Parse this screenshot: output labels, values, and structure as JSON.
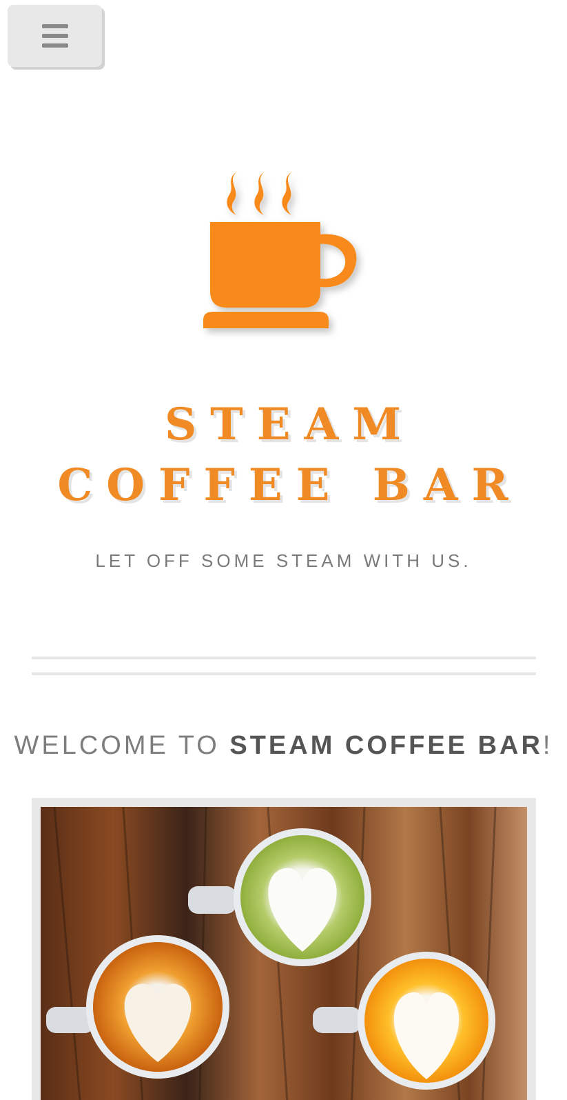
{
  "menu": {
    "icon": "hamburger-menu-icon"
  },
  "hero": {
    "logo_icon": "steaming-coffee-cup-icon",
    "title_line1": "STEAM",
    "title_line2": "COFFEE BAR",
    "tagline": "LET OFF SOME STEAM WITH US."
  },
  "welcome": {
    "prefix": "WELCOME TO ",
    "name": "STEAM COFFEE BAR",
    "suffix": "!"
  },
  "photo": {
    "subject": "latte-art-cups-photo"
  },
  "colors": {
    "accent": "#f08a24",
    "text_gray": "#7a7a7a",
    "button_bg": "#e8e8e8"
  }
}
